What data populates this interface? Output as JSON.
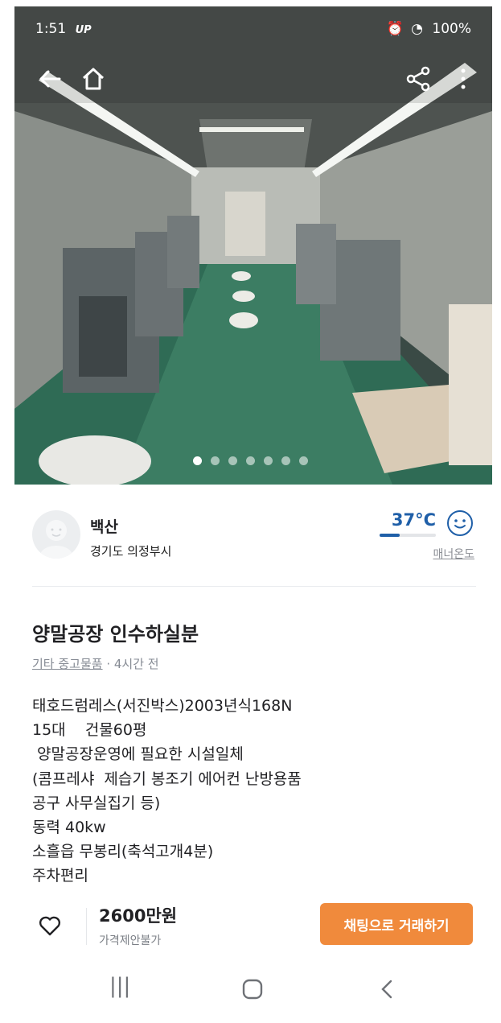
{
  "status_bar": {
    "time": "1:51",
    "carrier": "UP",
    "battery": "100%"
  },
  "image_carousel": {
    "slides": 7,
    "active_index": 0
  },
  "seller": {
    "nickname": "백산",
    "region": "경기도 의정부시",
    "manner_temp": "37°C",
    "manner_label": "매너온도",
    "manner_fill": 0.36
  },
  "post": {
    "title": "양말공장 인수하실분",
    "category": "기타 중고물품",
    "time_ago": " · 4시간 전",
    "description_lines": [
      "태호드럼레스(서진박스)2003년식168N",
      "15대    건물60평",
      " 양말공장운영에 필요한 시설일체",
      "(콤프레샤  제습기 봉조기 에어컨 난방용품",
      "공구 사무실집기 등)",
      "동력 40kw",
      "소흘읍 무봉리(축석고개4분)",
      "주차편리"
    ]
  },
  "bottom_bar": {
    "price": "2600만원",
    "price_note": "가격제안불가",
    "chat_button": "채팅으로 거래하기"
  },
  "colors": {
    "accent": "#f08a3c",
    "temp_blue": "#1f5fa8"
  },
  "icons": [
    "back-arrow-icon",
    "home-icon",
    "share-icon",
    "more-icon",
    "heart-icon",
    "smile-icon"
  ]
}
